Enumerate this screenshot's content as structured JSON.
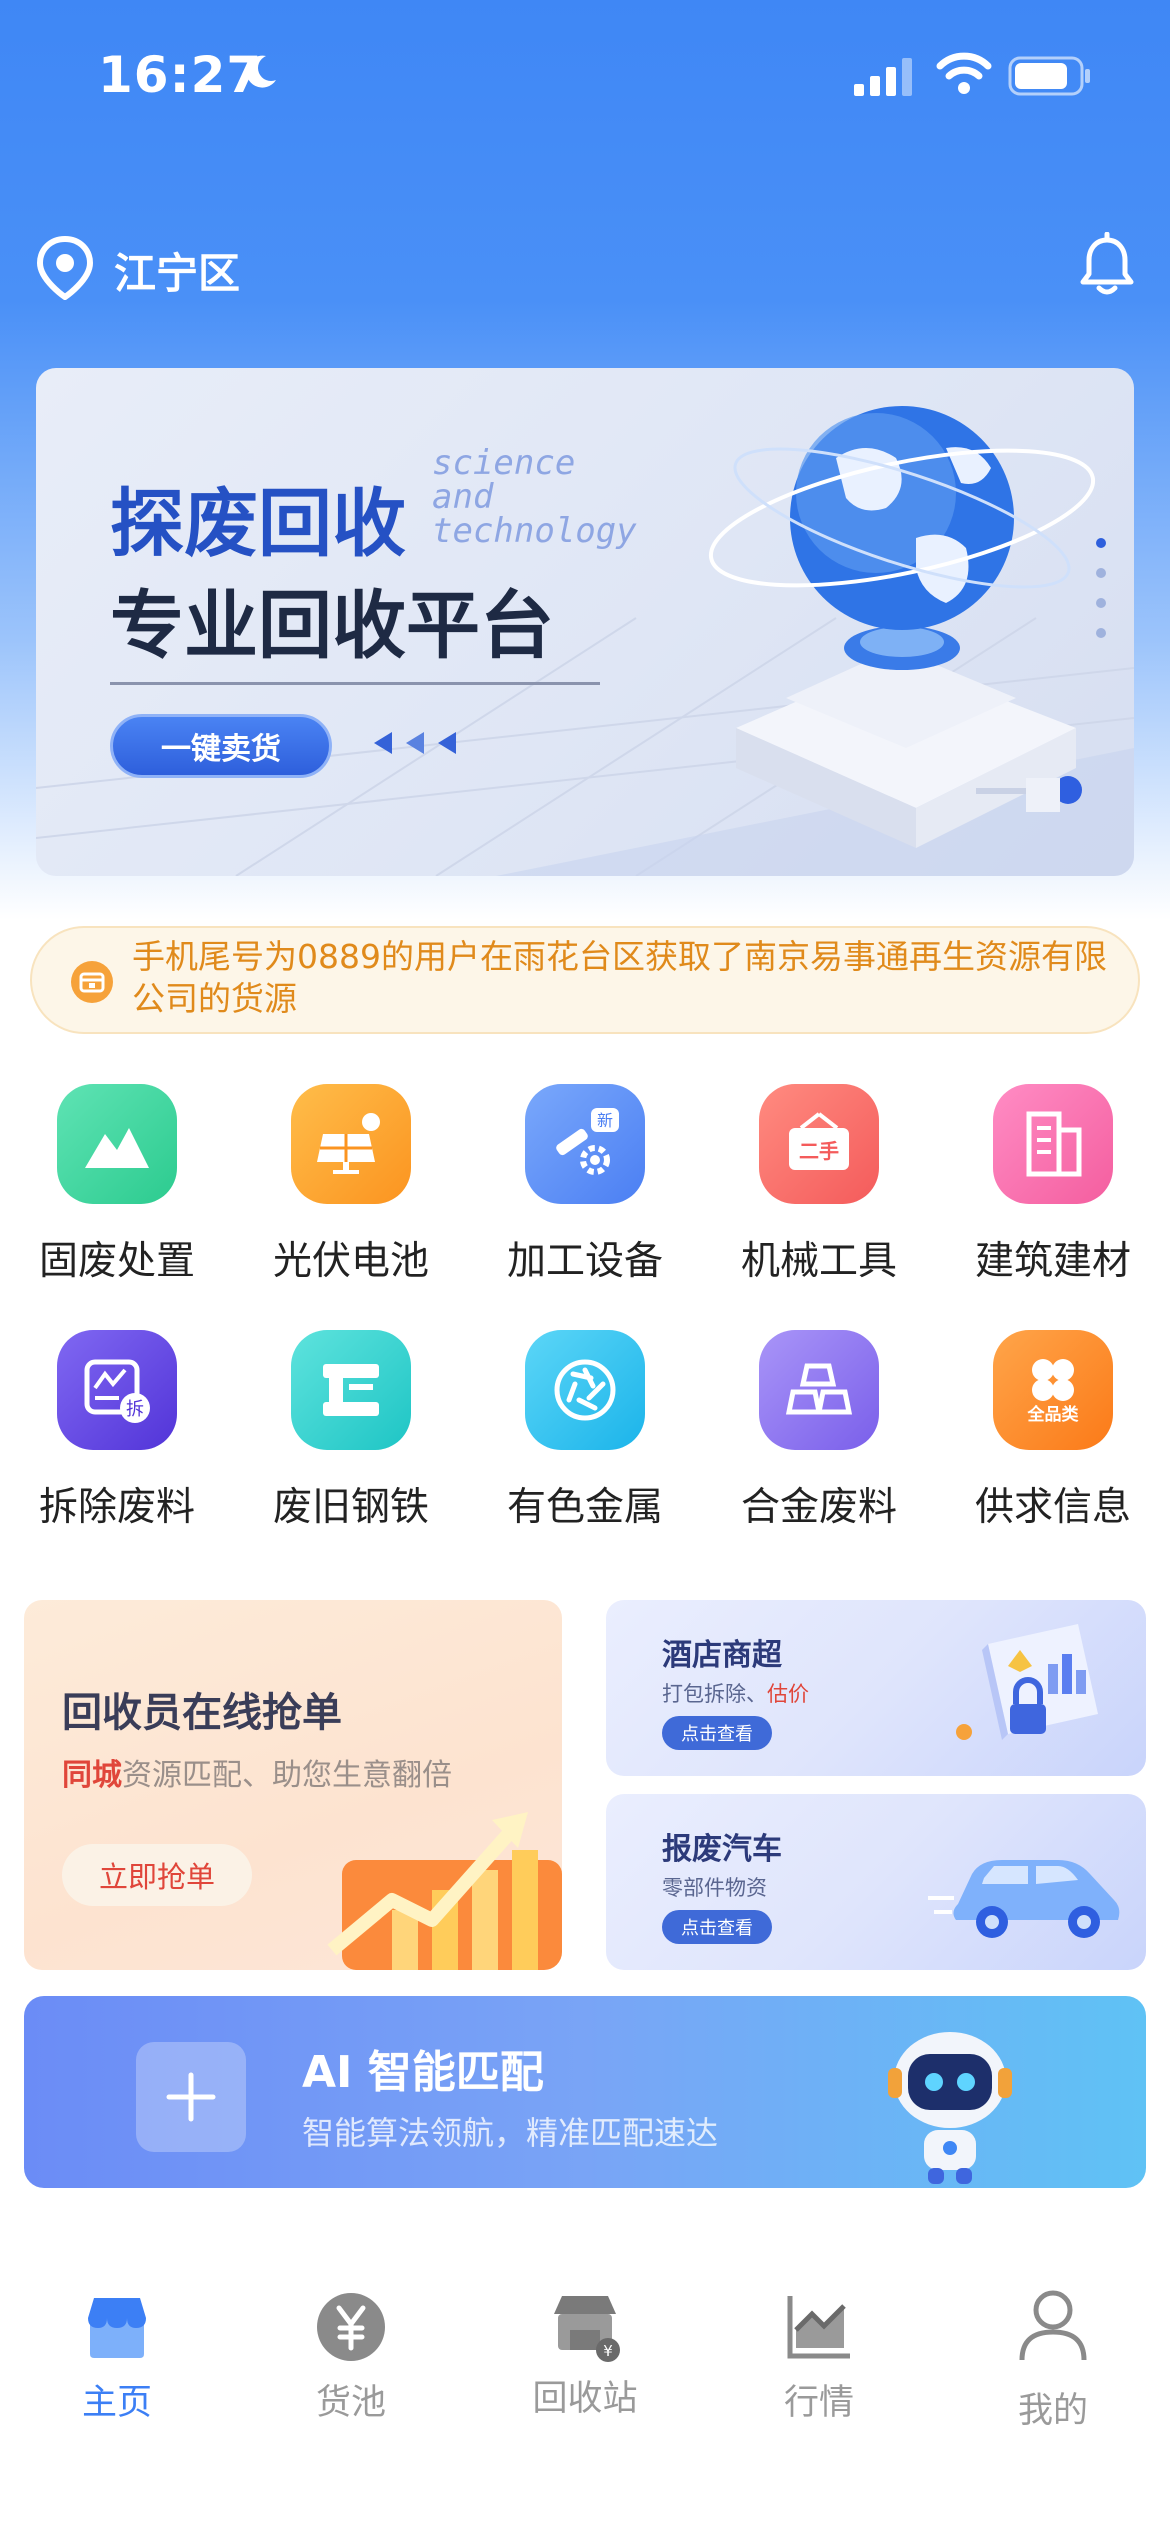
{
  "status_bar": {
    "time": "16:27"
  },
  "header": {
    "location": "江宁区"
  },
  "banner": {
    "title_line1": "探废回收",
    "title_line2": "专业回收平台",
    "tagline_1": "science",
    "tagline_2": "and",
    "tagline_3": "technology",
    "button_label": "一键卖货"
  },
  "notice": {
    "text": "手机尾号为0889的用户在雨花台区获取了南京易事通再生资源有限公司的货源"
  },
  "categories": [
    {
      "label": "固废处置",
      "icon": "mountain-icon",
      "color": "#3fd6a0"
    },
    {
      "label": "光伏电池",
      "icon": "solar-panel-icon",
      "color": "#fba33a"
    },
    {
      "label": "加工设备",
      "icon": "machine-arm-icon",
      "color": "#5c8ff7",
      "badge": "新"
    },
    {
      "label": "机械工具",
      "icon": "second-hand-sign-icon",
      "color": "#f76b6b",
      "badge": "二手"
    },
    {
      "label": "建筑建材",
      "icon": "building-icon",
      "color": "#f76ba8"
    },
    {
      "label": "拆除废料",
      "icon": "demolition-icon",
      "color": "#6a52e6",
      "badge": "拆"
    },
    {
      "label": "废旧钢铁",
      "icon": "steel-icon",
      "color": "#33cfcf"
    },
    {
      "label": "有色金属",
      "icon": "aperture-icon",
      "color": "#33c6ef"
    },
    {
      "label": "合金废料",
      "icon": "alloy-bars-icon",
      "color": "#9078f2"
    },
    {
      "label": "供求信息",
      "icon": "clover-icon",
      "color": "#fb8a2c",
      "badge": "全品类"
    }
  ],
  "promo_main": {
    "title": "回收员在线抢单",
    "subtitle_highlight": "同城",
    "subtitle_rest": "资源匹配、助您生意翻倍",
    "button_label": "立即抢单"
  },
  "promo_hotel": {
    "title": "酒店商超",
    "subtitle_prefix": "打包拆除、",
    "subtitle_highlight": "估价",
    "button_label": "点击查看"
  },
  "promo_car": {
    "title": "报废汽车",
    "subtitle": "零部件物资",
    "button_label": "点击查看"
  },
  "ai_card": {
    "title": "AI 智能匹配",
    "subtitle": "智能算法领航，精准匹配速达"
  },
  "tabbar": {
    "items": [
      {
        "label": "主页",
        "icon": "shop-icon",
        "active": true
      },
      {
        "label": "货池",
        "icon": "yuan-coin-icon",
        "active": false
      },
      {
        "label": "回收站",
        "icon": "recycle-station-icon",
        "active": false
      },
      {
        "label": "行情",
        "icon": "market-chart-icon",
        "active": false
      },
      {
        "label": "我的",
        "icon": "user-icon",
        "active": false
      }
    ]
  }
}
